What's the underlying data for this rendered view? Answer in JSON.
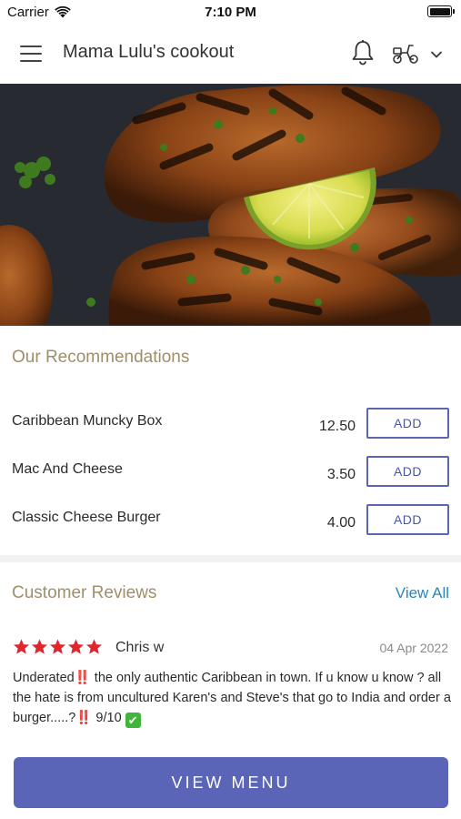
{
  "status_bar": {
    "carrier": "Carrier",
    "time": "7:10 PM"
  },
  "header": {
    "title": "Mama Lulu's cookout",
    "icons": [
      "menu-icon",
      "bell-icon",
      "scooter-icon",
      "chevron-down-icon"
    ]
  },
  "hero": {
    "image": "grilled-chicken-with-lime-photo"
  },
  "recommendations": {
    "title": "Our Recommendations",
    "items": [
      {
        "name": "Caribbean Muncky Box",
        "price": "12.50",
        "button": "ADD"
      },
      {
        "name": "Mac And Cheese",
        "price": "3.50",
        "button": "ADD"
      },
      {
        "name": "Classic Cheese Burger",
        "price": "4.00",
        "button": "ADD"
      }
    ]
  },
  "reviews": {
    "title": "Customer Reviews",
    "view_all": "View All",
    "items": [
      {
        "rating": 5,
        "reviewer": "Chris w",
        "date": "04 Apr 2022",
        "text_part1": "Underated",
        "text_part2": " the only authentic Caribbean in town. If u know u know ?  all the hate is from uncultured Karen's and Steve's that go to India and order a burger.....?",
        "text_part3": " 9/10 ",
        "emoji_exclaim": "‼️",
        "emoji_check": "✔"
      }
    ]
  },
  "colors": {
    "accent": "#5b65b8",
    "section_title": "#a08e6a",
    "link": "#2a88b8",
    "star": "#e0262c"
  },
  "footer": {
    "view_menu": "VIEW MENU"
  }
}
